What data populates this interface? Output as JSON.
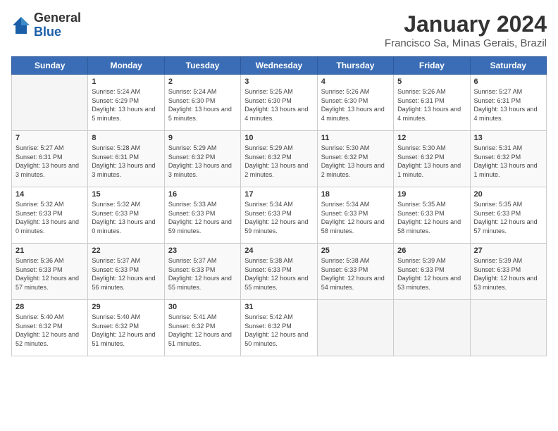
{
  "logo": {
    "general": "General",
    "blue": "Blue"
  },
  "title": "January 2024",
  "subtitle": "Francisco Sa, Minas Gerais, Brazil",
  "days_of_week": [
    "Sunday",
    "Monday",
    "Tuesday",
    "Wednesday",
    "Thursday",
    "Friday",
    "Saturday"
  ],
  "weeks": [
    [
      {
        "day": "",
        "sunrise": "",
        "sunset": "",
        "daylight": ""
      },
      {
        "day": "1",
        "sunrise": "Sunrise: 5:24 AM",
        "sunset": "Sunset: 6:29 PM",
        "daylight": "Daylight: 13 hours and 5 minutes."
      },
      {
        "day": "2",
        "sunrise": "Sunrise: 5:24 AM",
        "sunset": "Sunset: 6:30 PM",
        "daylight": "Daylight: 13 hours and 5 minutes."
      },
      {
        "day": "3",
        "sunrise": "Sunrise: 5:25 AM",
        "sunset": "Sunset: 6:30 PM",
        "daylight": "Daylight: 13 hours and 4 minutes."
      },
      {
        "day": "4",
        "sunrise": "Sunrise: 5:26 AM",
        "sunset": "Sunset: 6:30 PM",
        "daylight": "Daylight: 13 hours and 4 minutes."
      },
      {
        "day": "5",
        "sunrise": "Sunrise: 5:26 AM",
        "sunset": "Sunset: 6:31 PM",
        "daylight": "Daylight: 13 hours and 4 minutes."
      },
      {
        "day": "6",
        "sunrise": "Sunrise: 5:27 AM",
        "sunset": "Sunset: 6:31 PM",
        "daylight": "Daylight: 13 hours and 4 minutes."
      }
    ],
    [
      {
        "day": "7",
        "sunrise": "Sunrise: 5:27 AM",
        "sunset": "Sunset: 6:31 PM",
        "daylight": "Daylight: 13 hours and 3 minutes."
      },
      {
        "day": "8",
        "sunrise": "Sunrise: 5:28 AM",
        "sunset": "Sunset: 6:31 PM",
        "daylight": "Daylight: 13 hours and 3 minutes."
      },
      {
        "day": "9",
        "sunrise": "Sunrise: 5:29 AM",
        "sunset": "Sunset: 6:32 PM",
        "daylight": "Daylight: 13 hours and 3 minutes."
      },
      {
        "day": "10",
        "sunrise": "Sunrise: 5:29 AM",
        "sunset": "Sunset: 6:32 PM",
        "daylight": "Daylight: 13 hours and 2 minutes."
      },
      {
        "day": "11",
        "sunrise": "Sunrise: 5:30 AM",
        "sunset": "Sunset: 6:32 PM",
        "daylight": "Daylight: 13 hours and 2 minutes."
      },
      {
        "day": "12",
        "sunrise": "Sunrise: 5:30 AM",
        "sunset": "Sunset: 6:32 PM",
        "daylight": "Daylight: 13 hours and 1 minute."
      },
      {
        "day": "13",
        "sunrise": "Sunrise: 5:31 AM",
        "sunset": "Sunset: 6:32 PM",
        "daylight": "Daylight: 13 hours and 1 minute."
      }
    ],
    [
      {
        "day": "14",
        "sunrise": "Sunrise: 5:32 AM",
        "sunset": "Sunset: 6:33 PM",
        "daylight": "Daylight: 13 hours and 0 minutes."
      },
      {
        "day": "15",
        "sunrise": "Sunrise: 5:32 AM",
        "sunset": "Sunset: 6:33 PM",
        "daylight": "Daylight: 13 hours and 0 minutes."
      },
      {
        "day": "16",
        "sunrise": "Sunrise: 5:33 AM",
        "sunset": "Sunset: 6:33 PM",
        "daylight": "Daylight: 12 hours and 59 minutes."
      },
      {
        "day": "17",
        "sunrise": "Sunrise: 5:34 AM",
        "sunset": "Sunset: 6:33 PM",
        "daylight": "Daylight: 12 hours and 59 minutes."
      },
      {
        "day": "18",
        "sunrise": "Sunrise: 5:34 AM",
        "sunset": "Sunset: 6:33 PM",
        "daylight": "Daylight: 12 hours and 58 minutes."
      },
      {
        "day": "19",
        "sunrise": "Sunrise: 5:35 AM",
        "sunset": "Sunset: 6:33 PM",
        "daylight": "Daylight: 12 hours and 58 minutes."
      },
      {
        "day": "20",
        "sunrise": "Sunrise: 5:35 AM",
        "sunset": "Sunset: 6:33 PM",
        "daylight": "Daylight: 12 hours and 57 minutes."
      }
    ],
    [
      {
        "day": "21",
        "sunrise": "Sunrise: 5:36 AM",
        "sunset": "Sunset: 6:33 PM",
        "daylight": "Daylight: 12 hours and 57 minutes."
      },
      {
        "day": "22",
        "sunrise": "Sunrise: 5:37 AM",
        "sunset": "Sunset: 6:33 PM",
        "daylight": "Daylight: 12 hours and 56 minutes."
      },
      {
        "day": "23",
        "sunrise": "Sunrise: 5:37 AM",
        "sunset": "Sunset: 6:33 PM",
        "daylight": "Daylight: 12 hours and 55 minutes."
      },
      {
        "day": "24",
        "sunrise": "Sunrise: 5:38 AM",
        "sunset": "Sunset: 6:33 PM",
        "daylight": "Daylight: 12 hours and 55 minutes."
      },
      {
        "day": "25",
        "sunrise": "Sunrise: 5:38 AM",
        "sunset": "Sunset: 6:33 PM",
        "daylight": "Daylight: 12 hours and 54 minutes."
      },
      {
        "day": "26",
        "sunrise": "Sunrise: 5:39 AM",
        "sunset": "Sunset: 6:33 PM",
        "daylight": "Daylight: 12 hours and 53 minutes."
      },
      {
        "day": "27",
        "sunrise": "Sunrise: 5:39 AM",
        "sunset": "Sunset: 6:33 PM",
        "daylight": "Daylight: 12 hours and 53 minutes."
      }
    ],
    [
      {
        "day": "28",
        "sunrise": "Sunrise: 5:40 AM",
        "sunset": "Sunset: 6:32 PM",
        "daylight": "Daylight: 12 hours and 52 minutes."
      },
      {
        "day": "29",
        "sunrise": "Sunrise: 5:40 AM",
        "sunset": "Sunset: 6:32 PM",
        "daylight": "Daylight: 12 hours and 51 minutes."
      },
      {
        "day": "30",
        "sunrise": "Sunrise: 5:41 AM",
        "sunset": "Sunset: 6:32 PM",
        "daylight": "Daylight: 12 hours and 51 minutes."
      },
      {
        "day": "31",
        "sunrise": "Sunrise: 5:42 AM",
        "sunset": "Sunset: 6:32 PM",
        "daylight": "Daylight: 12 hours and 50 minutes."
      },
      {
        "day": "",
        "sunrise": "",
        "sunset": "",
        "daylight": ""
      },
      {
        "day": "",
        "sunrise": "",
        "sunset": "",
        "daylight": ""
      },
      {
        "day": "",
        "sunrise": "",
        "sunset": "",
        "daylight": ""
      }
    ]
  ]
}
